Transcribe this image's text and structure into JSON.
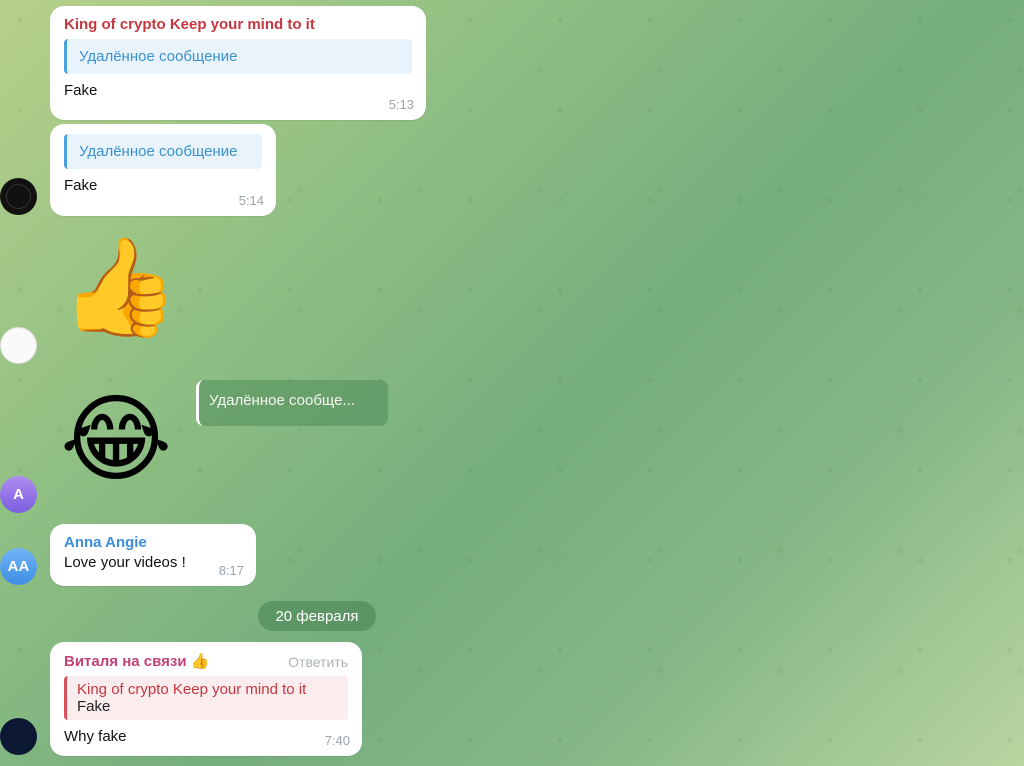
{
  "msg1": {
    "sender": "King of crypto Keep your mind to it",
    "reply": "Удалённое сообщение",
    "text": "Fake",
    "time": "5:13"
  },
  "msg2": {
    "reply": "Удалённое сообщение",
    "text": "Fake",
    "time": "5:14"
  },
  "sticker1": {
    "emoji": "👍"
  },
  "sticker2": {
    "emoji": "😂",
    "reply": "Удалённое сообще..."
  },
  "avatar_a": {
    "initials": "A"
  },
  "msg3": {
    "avatar_initials": "AA",
    "sender": "Anna Angie",
    "text": "Love your videos !",
    "time": "8:17"
  },
  "date_separator": "20 февраля",
  "msg4": {
    "sender": "Виталя на связи 👍",
    "reply_action": "Ответить",
    "reply_sender": "King of crypto Keep your mind to it",
    "reply_text": "Fake",
    "text": "Why fake",
    "time": "7:40"
  },
  "colors": {
    "bubble": "#ffffff",
    "accent_blue": "#3b8ed8",
    "accent_red": "#c6373f"
  }
}
